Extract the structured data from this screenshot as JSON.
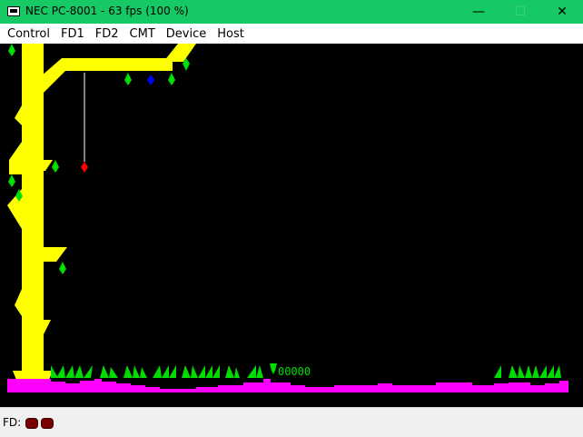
{
  "window": {
    "title": "NEC PC-8001 - 63 fps (100 %)",
    "minimize_symbol": "—",
    "maximize_symbol": "☐",
    "close_symbol": "✕"
  },
  "menu": {
    "items": [
      "Control",
      "FD1",
      "FD2",
      "CMT",
      "Device",
      "Host"
    ]
  },
  "game": {
    "score": "00000",
    "colors": {
      "background": "#000000",
      "tree": "#ffff00",
      "grass": "#00ff00",
      "ground": "#ff00ff",
      "red_gem": "#ff0000",
      "blue_gem": "#0000ff",
      "rope": "#ffffff"
    }
  },
  "status": {
    "fd_label": "FD:",
    "drive_count": 2,
    "drive_led_color": "#7a0000"
  }
}
